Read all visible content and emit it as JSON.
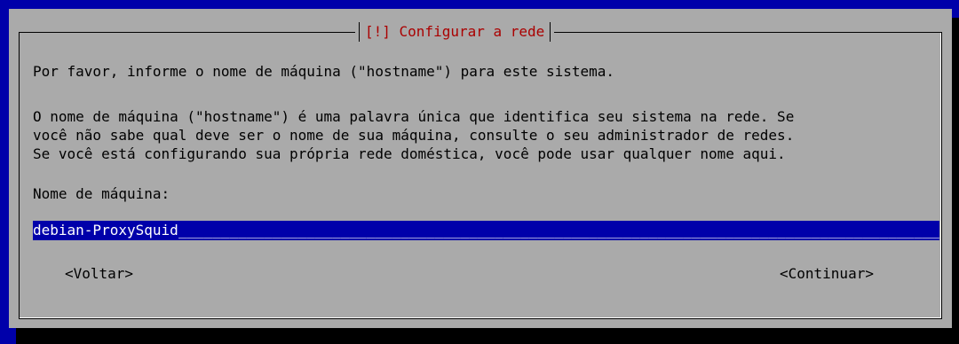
{
  "dialog": {
    "title": "[!] Configurar a rede",
    "prompt": "Por favor, informe o nome de máquina (\"hostname\") para este sistema.",
    "description": [
      "O nome de máquina (\"hostname\") é uma palavra única que identifica seu sistema na rede. Se",
      "você não sabe qual deve ser o nome de sua máquina, consulte o seu administrador de redes.",
      "Se você está configurando sua própria rede doméstica, você pode usar qualquer nome aqui."
    ],
    "field_label": "Nome de máquina:",
    "hostname_value": "debian-ProxySquid",
    "back_button": "<Voltar>",
    "continue_button": "<Continuar>"
  },
  "colors": {
    "background": "#0000aa",
    "dialog": "#aaaaaa",
    "title": "#aa0000",
    "input_bg": "#0000aa",
    "input_fg": "#ffffff",
    "shadow": "#000000"
  }
}
